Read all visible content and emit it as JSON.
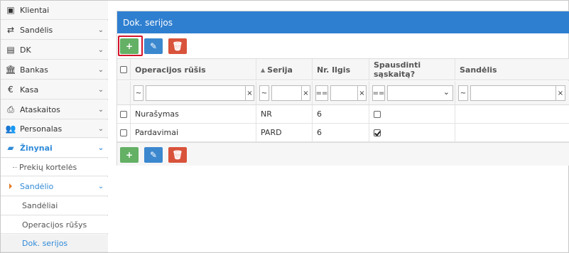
{
  "sidebar": {
    "items": [
      {
        "label": "Klientai",
        "icon": "address-book-icon"
      },
      {
        "label": "Sandėlis",
        "icon": "exchange-icon"
      },
      {
        "label": "DK",
        "icon": "book-icon"
      },
      {
        "label": "Bankas",
        "icon": "bank-icon"
      },
      {
        "label": "Kasa",
        "icon": "euro-icon"
      },
      {
        "label": "Ataskaitos",
        "icon": "print-icon"
      },
      {
        "label": "Personalas",
        "icon": "users-icon"
      },
      {
        "label": "Žinynai",
        "icon": "folder-open-icon"
      }
    ],
    "sub": [
      {
        "label": "Prekių kortelės"
      },
      {
        "label": "Sandėlio"
      }
    ],
    "subsub": [
      {
        "label": "Sandėliai"
      },
      {
        "label": "Operacijos rūšys"
      },
      {
        "label": "Dok. serijos"
      }
    ]
  },
  "panel": {
    "title": "Dok. serijos",
    "buttons": {
      "add": "+",
      "edit": "✎",
      "delete": "🗑"
    }
  },
  "table": {
    "columns": [
      "Operacijos rūšis",
      "Serija",
      "Nr. Ilgis",
      "Spausdinti sąskaitą?",
      "Sandėlis"
    ],
    "sort_indicator": "▲",
    "filters": {
      "op_like": "~",
      "op_eq": "==",
      "clear": "×",
      "select_caret": "⌄"
    },
    "rows": [
      {
        "operacija": "Nurašymas",
        "serija": "NR",
        "ilgis": "6",
        "spausdinti": false,
        "sandelis": ""
      },
      {
        "operacija": "Pardavimai",
        "serija": "PARD",
        "ilgis": "6",
        "spausdinti": true,
        "sandelis": ""
      }
    ]
  },
  "colors": {
    "header": "#2f7fd0",
    "accent": "#2f8ad8",
    "add": "#64b065",
    "edit": "#3b88cf",
    "delete": "#d9533b",
    "highlight": "#d3142a"
  }
}
